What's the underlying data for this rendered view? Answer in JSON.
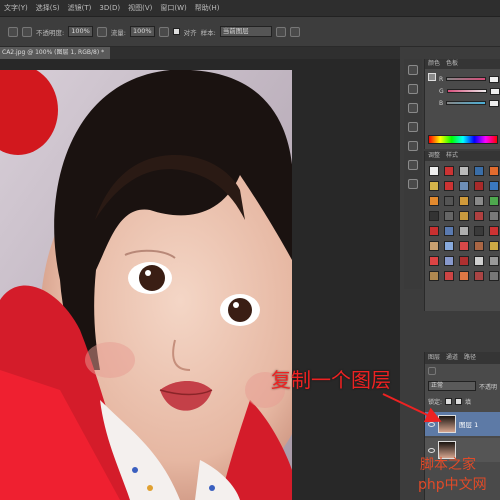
{
  "menubar": {
    "items": [
      "文字(Y)",
      "选择(S)",
      "滤镜(T)",
      "3D(D)",
      "视图(V)",
      "窗口(W)",
      "帮助(H)"
    ]
  },
  "options": {
    "opacity_label": "不透明度:",
    "opacity_value": "100%",
    "flow_label": "流量:",
    "flow_value": "100%",
    "align_label": "对齐",
    "sample_label": "样本:",
    "sample_value": "当前图层"
  },
  "document": {
    "tab_title": "CA2.jpg @ 100% (图层 1, RGB/8) *"
  },
  "color_panel": {
    "tabs": [
      "颜色",
      "色板"
    ],
    "channels": [
      "R",
      "G",
      "B"
    ],
    "channel_colors": [
      "#d84c7a",
      "#4ab0d8",
      "#c7d0d8"
    ]
  },
  "styles_panel": {
    "tabs": [
      "调整",
      "样式"
    ],
    "swatch_colors": [
      "#eeeeee",
      "#c33",
      "#bbb",
      "#3a6ea8",
      "#e26b2e",
      "#d4b44a",
      "#c33",
      "#6e8fb8",
      "#a82a2a",
      "#3a78c0",
      "#e38a2e",
      "#555",
      "#d09a3a",
      "#8a8a8a",
      "#4ea84e",
      "#333",
      "#666",
      "#c79a3e",
      "#b04040",
      "#7a7a7a",
      "#c93030",
      "#5a7ab0",
      "#b0b0b0",
      "#3a3a3a",
      "#cc3333",
      "#c9a070",
      "#88aadd",
      "#d84848",
      "#aa6644",
      "#ccaa44",
      "#dd4444",
      "#8899cc",
      "#b03030",
      "#d0d0d0",
      "#999999",
      "#b08850",
      "#cc4444",
      "#dd7744",
      "#aa4444",
      "#777777"
    ]
  },
  "layers_panel": {
    "tabs": [
      "图层",
      "通道",
      "路径"
    ],
    "blend_mode": "正常",
    "opacity_label": "不透明",
    "lock_label": "锁定:",
    "fill_label": "填",
    "layer_name": "图层 1"
  },
  "annotation": {
    "text": "复制一个图层",
    "color": "#ee2222"
  },
  "watermark": {
    "line1": "脚本之家",
    "line2": "php中文网"
  }
}
